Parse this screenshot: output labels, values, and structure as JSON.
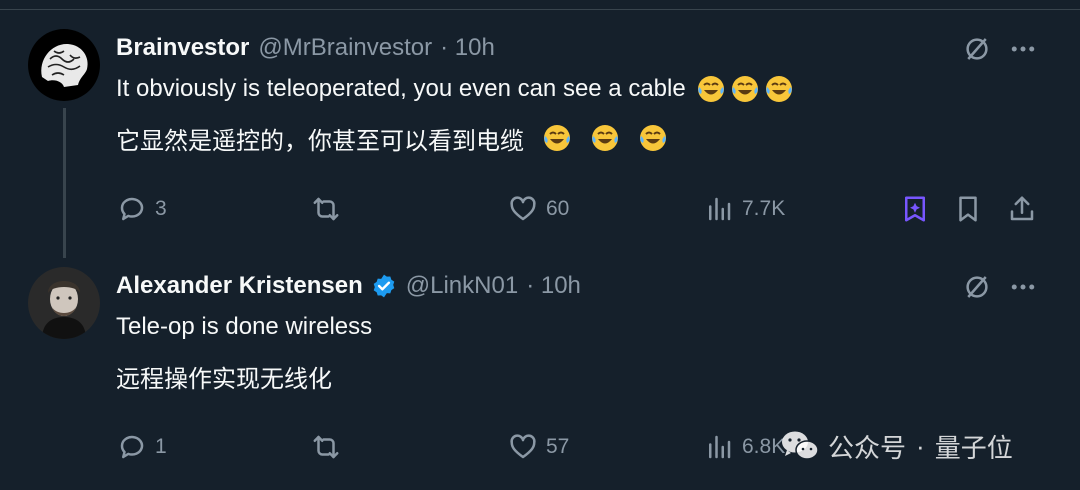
{
  "tweets": [
    {
      "author_name": "Brainvestor",
      "handle": "@MrBrainvestor",
      "time": "· 10h",
      "text": "It obviously is teleoperated, you even can see a cable",
      "translation": "它显然是遥控的，你甚至可以看到电缆",
      "replies": "3",
      "likes": "60",
      "views": "7.7K"
    },
    {
      "author_name": "Alexander Kristensen",
      "handle": "@LinkN01",
      "time": "· 10h",
      "verified": true,
      "text": "Tele-op is done wireless",
      "translation": "远程操作实现无线化",
      "replies": "1",
      "likes": "57",
      "views": "6.8K"
    }
  ],
  "watermark": {
    "channel": "公众号",
    "separator": "·",
    "name": "量子位"
  },
  "colors": {
    "background": "#15202b",
    "text": "#f7f9f9",
    "muted": "#8b98a5",
    "divider": "#38444d",
    "grok_purple": "#7856ff",
    "verified": "#1d9bf0"
  },
  "icons": [
    "reply-icon",
    "retweet-icon",
    "like-icon",
    "views-icon",
    "grok-icon",
    "bookmark-icon",
    "share-icon",
    "more-icon",
    "grok-slash-icon",
    "laughing-emoji",
    "verified-badge-icon",
    "wechat-icon"
  ]
}
